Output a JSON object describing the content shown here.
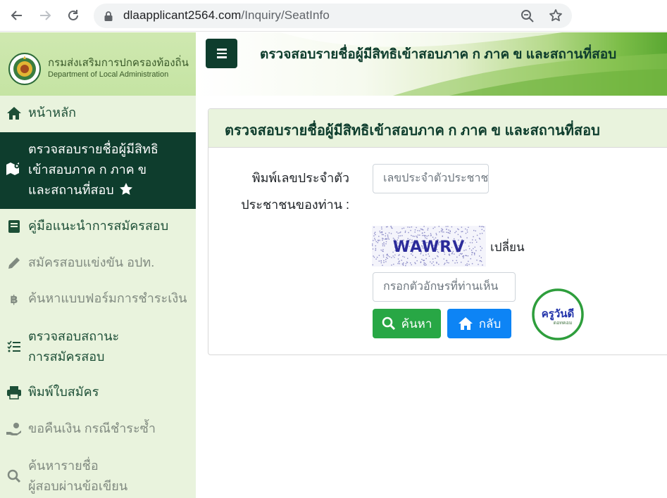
{
  "browser": {
    "url_host": "dlaapplicant2564.com",
    "url_path": "/Inquiry/SeatInfo"
  },
  "brand": {
    "name_th": "กรมส่งเสริมการปกครองท้องถิ่น",
    "name_en": "Department of Local Administration"
  },
  "header": {
    "title": "ตรวจสอบรายชื่อผู้มีสิทธิเข้าสอบภาค ก ภาค ข และสถานที่สอบ"
  },
  "sidebar": {
    "items": [
      {
        "label": "หน้าหลัก",
        "icon": "home-icon",
        "active": false,
        "muted": false
      },
      {
        "lines": [
          "ตรวจสอบรายชื่อผู้มีสิทธิ",
          "เข้าสอบภาค ก ภาค ข",
          "และสถานที่สอบ"
        ],
        "icon": "map-icon",
        "badge_icon": "star-icon",
        "active": true
      },
      {
        "label": "คู่มือแนะนำการสมัครสอบ",
        "icon": "book-icon",
        "active": false,
        "muted": false
      },
      {
        "label": "สมัครสอบแข่งขัน อปท.",
        "icon": "pencil-icon",
        "active": false,
        "muted": true
      },
      {
        "label": "ค้นหาแบบฟอร์มการชำระเงิน",
        "icon": "baht-icon",
        "active": false,
        "muted": true
      },
      {
        "lines": [
          "ตรวจสอบสถานะ",
          "การสมัครสอบ"
        ],
        "icon": "list-check-icon",
        "active": false,
        "muted": false
      },
      {
        "label": "พิมพ์ใบสมัคร",
        "icon": "printer-icon",
        "active": false,
        "muted": false
      },
      {
        "label": "ขอคืนเงิน กรณีชำระซ้ำ",
        "icon": "hand-money-icon",
        "active": false,
        "muted": true
      },
      {
        "lines": [
          "ค้นหารายชื่อ",
          "ผู้สอบผ่านข้อเขียน"
        ],
        "icon": "search-icon",
        "active": false,
        "muted": true
      }
    ]
  },
  "card": {
    "title": "ตรวจสอบรายชื่อผู้มีสิทธิเข้าสอบภาค ก ภาค ข และสถานที่สอบ",
    "id_label_line1": "พิมพ์เลขประจำตัว",
    "id_label_line2": "ประชาชนของท่าน :",
    "id_placeholder": "เลขประจำตัวประชาชน",
    "captcha_text": "WAWRV",
    "change_label": "เปลี่ยน",
    "captcha_placeholder": "กรอกตัวอักษรที่ท่านเห็น",
    "search_button": "ค้นหา",
    "back_button": "กลับ"
  },
  "watermark": {
    "text": "ครูวันดี",
    "sub": "ดอทคอม"
  },
  "colors": {
    "primary_dark": "#0e3d2d",
    "sidebar_bg": "#e9f3dd",
    "search_green": "#28a745",
    "back_blue": "#0d84f5"
  }
}
